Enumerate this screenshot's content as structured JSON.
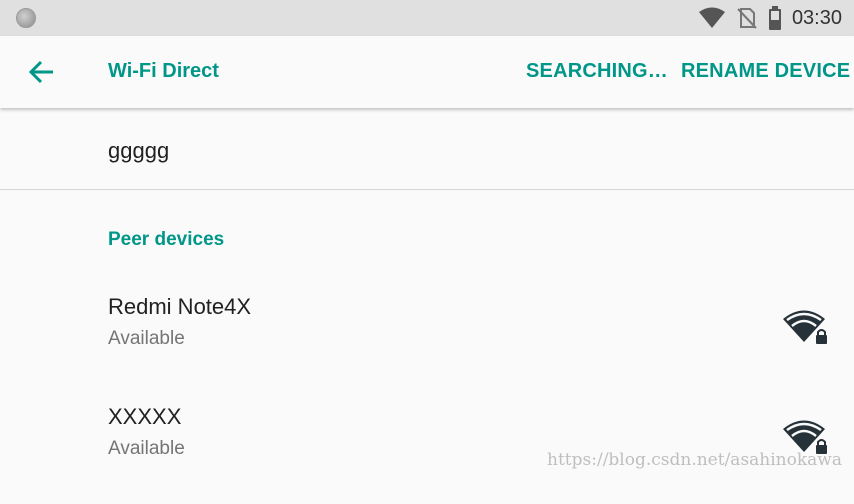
{
  "status_bar": {
    "time": "03:30",
    "icons": [
      "notification-dot-icon",
      "wifi-signal-icon",
      "no-sim-icon",
      "battery-icon"
    ]
  },
  "app_bar": {
    "title": "Wi-Fi Direct",
    "back_icon": "arrow-back-icon",
    "actions": {
      "searching": "SEARCHING…",
      "rename": "RENAME DEVICE"
    }
  },
  "this_device": {
    "name": "ggggg"
  },
  "peer_section": {
    "header": "Peer devices",
    "peers": [
      {
        "name": "Redmi Note4X",
        "status": "Available",
        "icon": "wifi-lock-icon"
      },
      {
        "name": "XXXXX",
        "status": "Available",
        "icon": "wifi-lock-icon"
      }
    ]
  },
  "watermark": "https://blog.csdn.net/asahinokawa",
  "colors": {
    "accent": "#009688",
    "status_bar": "#e0e0e0",
    "background": "#fafafa"
  }
}
